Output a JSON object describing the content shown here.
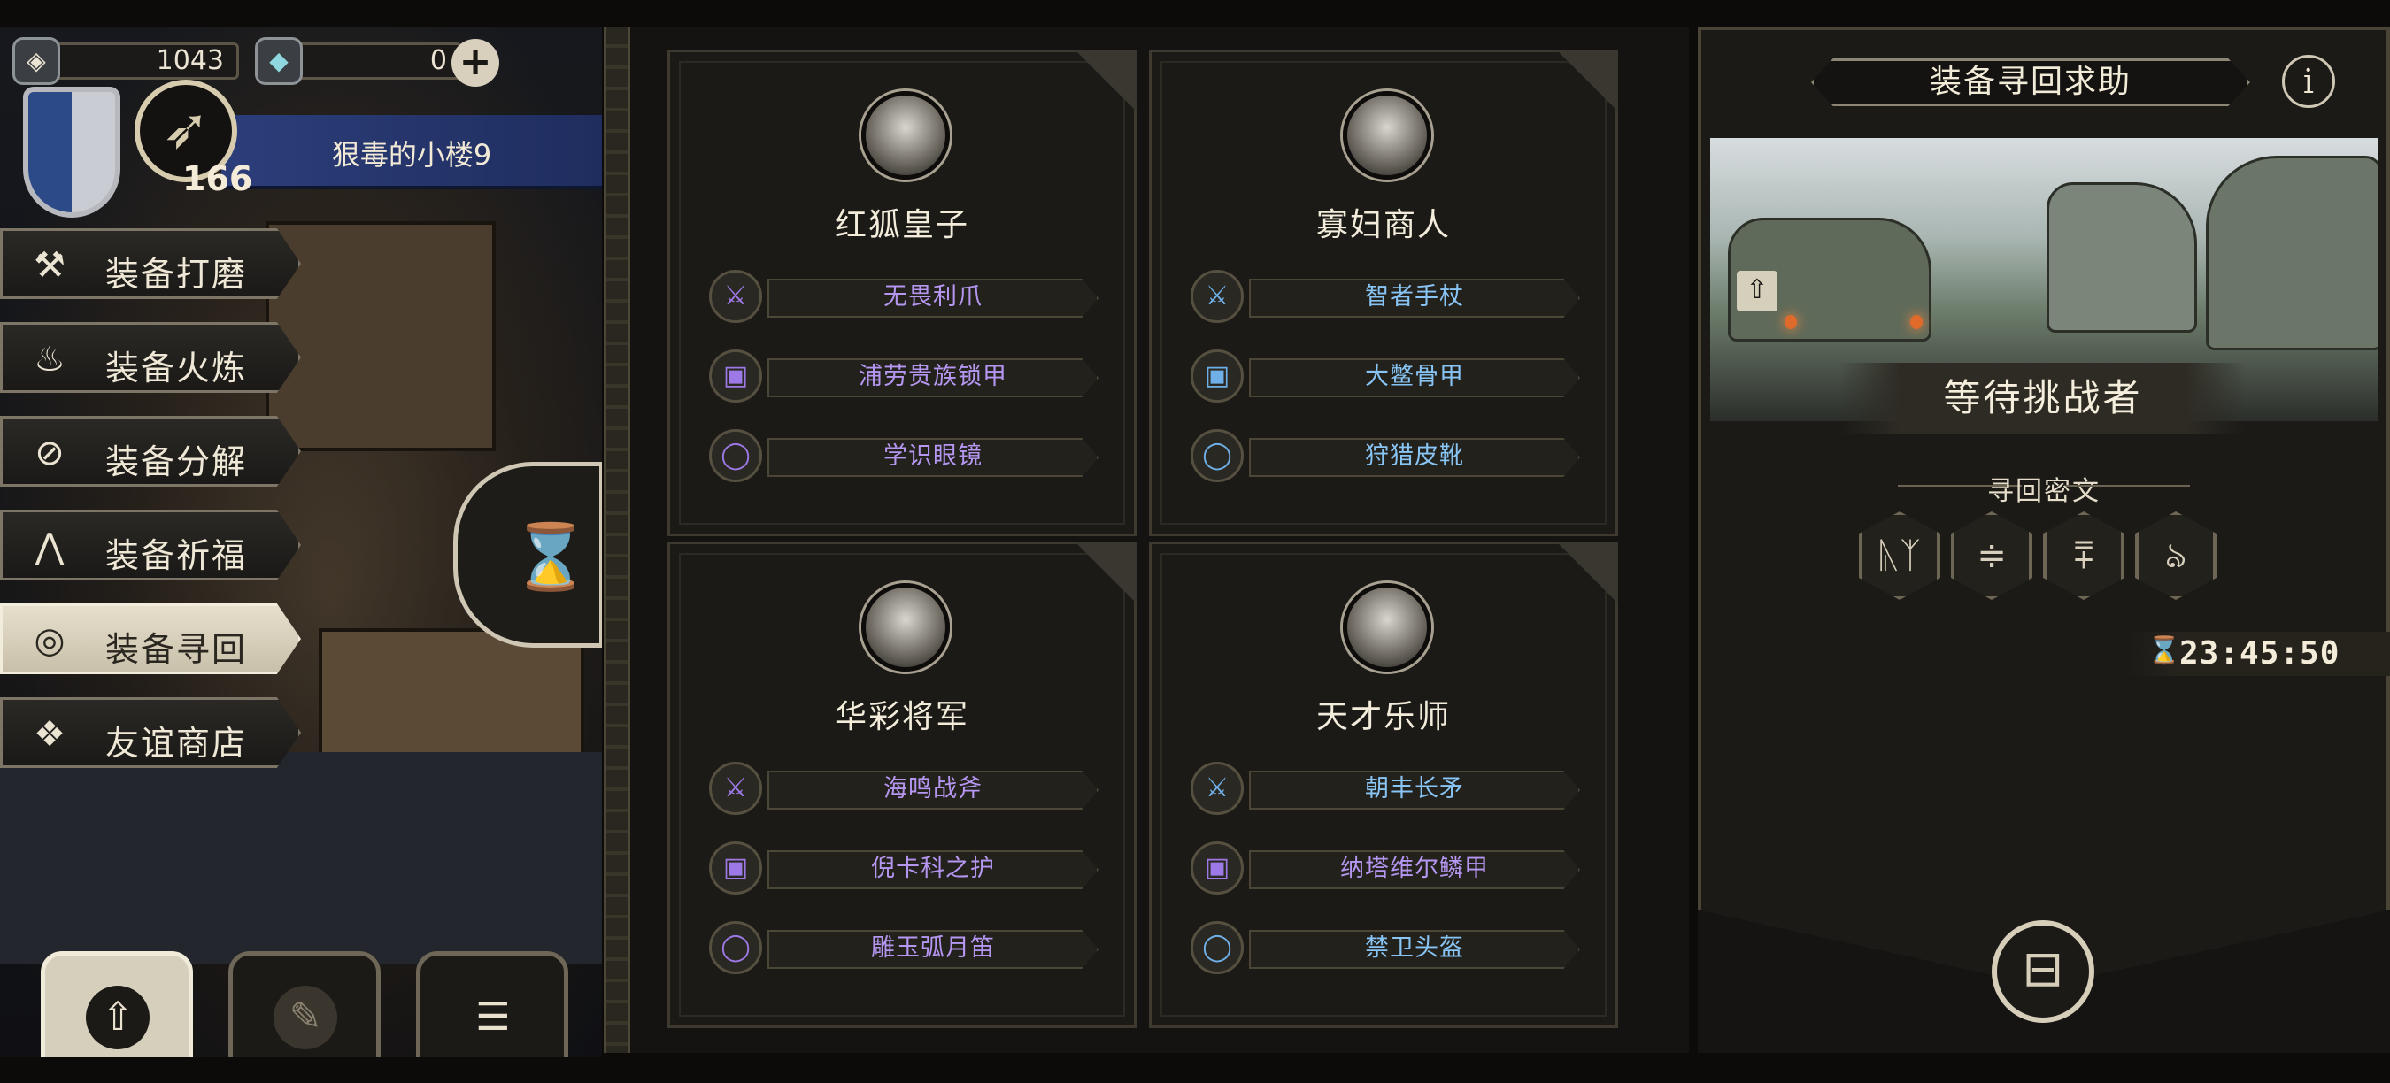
{
  "top_bar": {
    "currency_1_value": "1043",
    "currency_2_value": "0",
    "currency_1_icon": "silver-coin-icon",
    "currency_2_icon": "crystal-gem-icon",
    "plus_label": "+"
  },
  "player": {
    "level": "166",
    "location_name": "狠毒的小楼9"
  },
  "menu": {
    "items": [
      {
        "label": "装备打磨",
        "icon": "hammer-icon"
      },
      {
        "label": "装备火炼",
        "icon": "flame-icon"
      },
      {
        "label": "装备分解",
        "icon": "split-icon"
      },
      {
        "label": "装备祈福",
        "icon": "prayer-icon"
      },
      {
        "label": "装备寻回",
        "icon": "spiral-icon",
        "active": true
      },
      {
        "label": "友谊商店",
        "icon": "fox-icon"
      }
    ]
  },
  "cards": [
    {
      "name": "红狐皇子",
      "items": [
        {
          "label": "无畏利爪",
          "rarity": "purple",
          "icon": "sword-icon"
        },
        {
          "label": "浦劳贵族锁甲",
          "rarity": "purple",
          "icon": "armor-icon"
        },
        {
          "label": "学识眼镜",
          "rarity": "purple",
          "icon": "ring-icon"
        }
      ]
    },
    {
      "name": "寡妇商人",
      "items": [
        {
          "label": "智者手杖",
          "rarity": "blue",
          "icon": "sword-icon"
        },
        {
          "label": "大鳖骨甲",
          "rarity": "blue",
          "icon": "armor-icon"
        },
        {
          "label": "狩猎皮靴",
          "rarity": "blue",
          "icon": "ring-icon"
        }
      ]
    },
    {
      "name": "华彩将军",
      "items": [
        {
          "label": "海鸣战斧",
          "rarity": "purple",
          "icon": "sword-icon"
        },
        {
          "label": "倪卡科之护",
          "rarity": "purple",
          "icon": "armor-icon"
        },
        {
          "label": "雕玉弧月笛",
          "rarity": "purple",
          "icon": "ring-icon"
        }
      ]
    },
    {
      "name": "天才乐师",
      "items": [
        {
          "label": "朝丰长矛",
          "rarity": "blue",
          "icon": "sword-icon"
        },
        {
          "label": "纳塔维尔鳞甲",
          "rarity": "purple",
          "icon": "armor-icon"
        },
        {
          "label": "禁卫头盔",
          "rarity": "blue",
          "icon": "ring-icon"
        }
      ]
    }
  ],
  "right_panel": {
    "title": "装备寻回求助",
    "info_label": "i",
    "status": "等待挑战者",
    "runes_label": "寻回密文",
    "runes": [
      "ᚣᛉ",
      "≑",
      "⩱",
      "ঌ"
    ],
    "timer": "23:45:50"
  },
  "colors": {
    "purple_item": "#b597f2",
    "blue_item": "#88c4f4",
    "panel_bg": "#1b1a17",
    "frame": "#4a4436"
  }
}
